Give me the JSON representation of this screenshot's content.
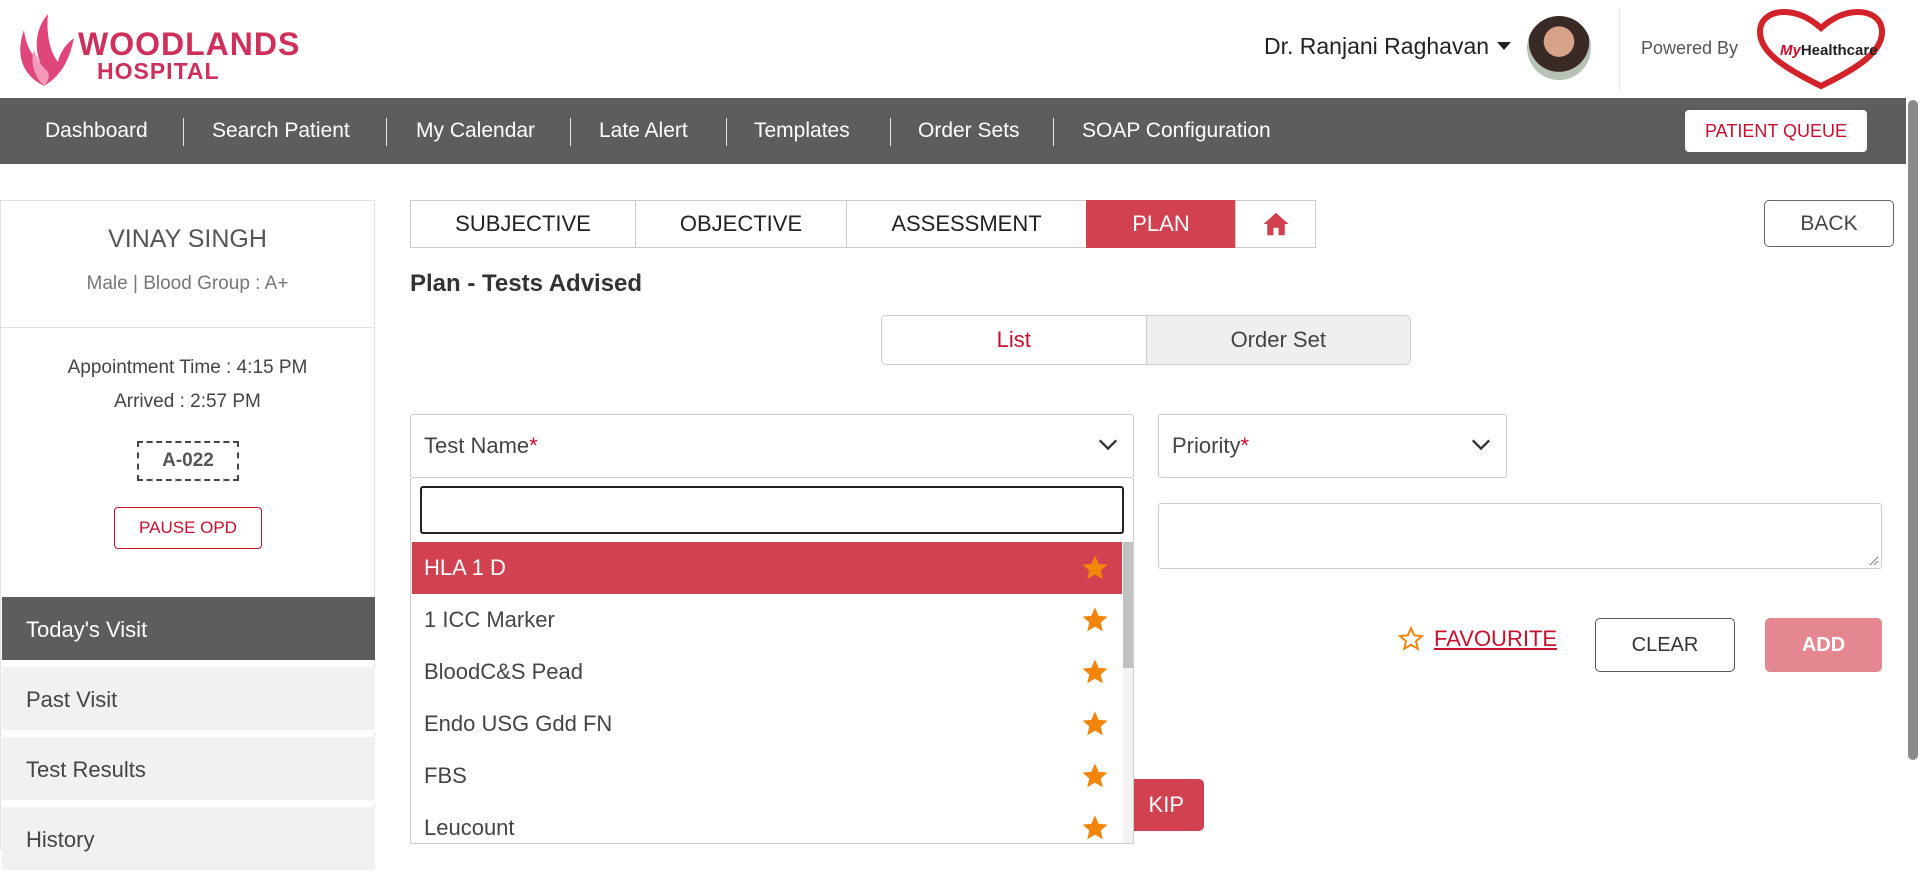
{
  "header": {
    "logo_line1": "WOODLANDS",
    "logo_line2": "HOSPITAL",
    "user_name": "Dr. Ranjani Raghavan",
    "powered_by": "Powered By",
    "partner_logo_my": "My",
    "partner_logo_rest": "Healthcare"
  },
  "nav": {
    "items": [
      "Dashboard",
      "Search Patient",
      "My Calendar",
      "Late Alert",
      "Templates",
      "Order Sets",
      "SOAP Configuration"
    ],
    "patient_queue": "PATIENT QUEUE"
  },
  "patient": {
    "name": "VINAY SINGH",
    "meta": "Male | Blood Group : A+",
    "appointment": "Appointment Time : 4:15 PM",
    "arrived": "Arrived : 2:57 PM",
    "token": "A-022",
    "pause_label": "PAUSE OPD"
  },
  "sidebar": {
    "items": [
      {
        "label": "Today's Visit",
        "active": true
      },
      {
        "label": "Past Visit",
        "active": false
      },
      {
        "label": "Test Results",
        "active": false
      },
      {
        "label": "History",
        "active": false
      }
    ]
  },
  "tabs": {
    "subjective": "SUBJECTIVE",
    "objective": "OBJECTIVE",
    "assessment": "ASSESSMENT",
    "plan": "PLAN",
    "active": "PLAN",
    "home_icon": "home-icon"
  },
  "back_label": "BACK",
  "section_title": "Plan - Tests Advised",
  "toggle": {
    "list": "List",
    "order_set": "Order Set",
    "selected": "List"
  },
  "form": {
    "test_name_label": "Test Name",
    "priority_label": "Priority",
    "required_mark": "*",
    "search_value": ""
  },
  "dropdown": {
    "options": [
      "HLA 1 D",
      "1 ICC Marker",
      "BloodC&S Pead",
      "Endo USG Gdd FN",
      "FBS",
      "Leucount"
    ],
    "highlighted": "HLA 1 D"
  },
  "actions": {
    "favourite": "FAVOURITE",
    "clear": "CLEAR",
    "add": "ADD",
    "skip_partial": "KIP"
  },
  "colors": {
    "brand_red": "#d1414f",
    "nav_gray": "#5d5d5d",
    "star_orange": "#f2850a"
  }
}
